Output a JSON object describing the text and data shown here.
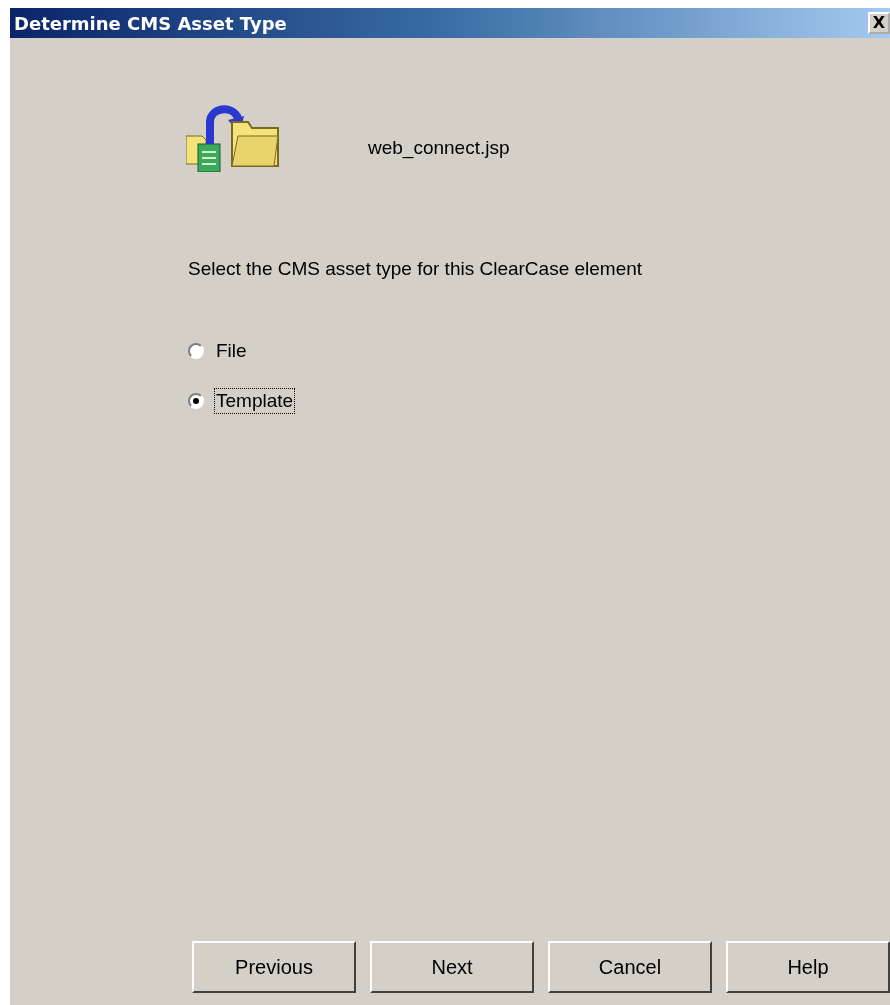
{
  "window": {
    "title": "Determine CMS Asset Type",
    "close_label": "X"
  },
  "file_name": "web_connect.jsp",
  "instruction": "Select the CMS asset type for this ClearCase element",
  "options": [
    {
      "label": "File",
      "selected": false,
      "focused": false
    },
    {
      "label": "Template",
      "selected": true,
      "focused": true
    }
  ],
  "buttons": [
    "Previous",
    "Next",
    "Cancel",
    "Help"
  ]
}
